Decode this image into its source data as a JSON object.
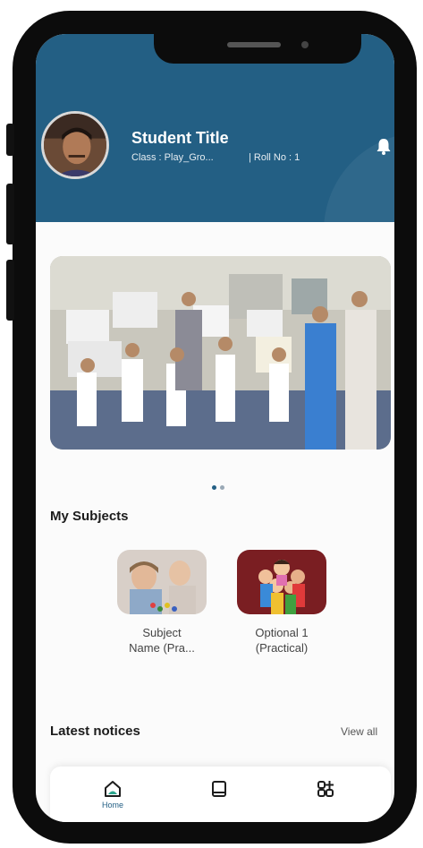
{
  "header": {
    "student_title": "Student Title",
    "class_text": "Class : Play_Gro...",
    "roll_text": "| Roll No : 1",
    "color": "#235f84"
  },
  "banner": {
    "slide_count": 2,
    "active_slide": 1
  },
  "subjects": {
    "title": "My Subjects",
    "items": [
      {
        "label_line1": "Subject",
        "label_line2": "Name (Pra...",
        "icon": "child-playing-photo"
      },
      {
        "label_line1": "Optional 1",
        "label_line2": "(Practical)",
        "icon": "children-group-illustration"
      }
    ]
  },
  "notices": {
    "title": "Latest notices",
    "view_all": "View all"
  },
  "bottom_nav": {
    "items": [
      {
        "label": "Home",
        "icon": "home-icon",
        "active": true
      },
      {
        "label": "",
        "icon": "book-icon",
        "active": false
      },
      {
        "label": "",
        "icon": "apps-add-icon",
        "active": false
      }
    ],
    "active_color": "#235f84"
  }
}
